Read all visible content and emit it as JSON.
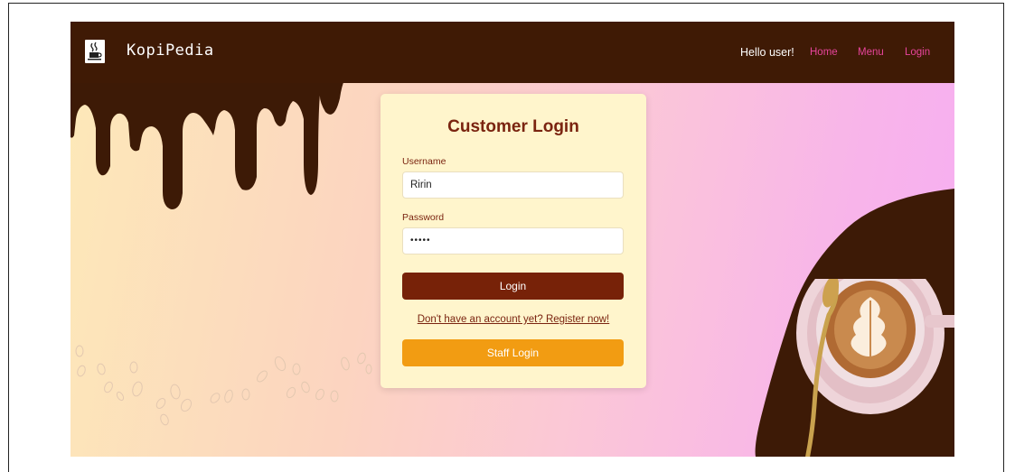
{
  "navbar": {
    "brand": "KopiPedia",
    "logo_icon": "coffee-cup-icon",
    "greeting": "Hello user!",
    "links": [
      "Home",
      "Menu",
      "Login"
    ]
  },
  "login": {
    "title": "Customer Login",
    "username_label": "Username",
    "username_value": "Ririn",
    "password_label": "Password",
    "password_value": "•••••",
    "login_button": "Login",
    "register_link": "Don't have an account yet? Register now!",
    "staff_button": "Staff Login"
  },
  "colors": {
    "navbar": "#3f1a05",
    "chocolate": "#3d1a06",
    "login_button": "#772208",
    "staff_button": "#f29c12",
    "card": "#fff5cc",
    "nav_link": "#e7449b",
    "title": "#7a2410"
  }
}
